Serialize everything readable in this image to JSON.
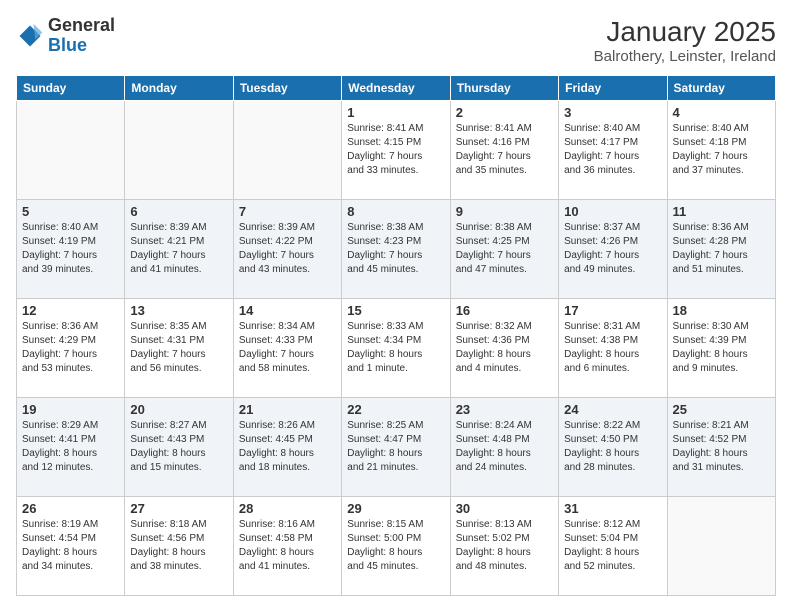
{
  "header": {
    "logo_general": "General",
    "logo_blue": "Blue",
    "month": "January 2025",
    "location": "Balrothery, Leinster, Ireland"
  },
  "weekdays": [
    "Sunday",
    "Monday",
    "Tuesday",
    "Wednesday",
    "Thursday",
    "Friday",
    "Saturday"
  ],
  "weeks": [
    [
      {
        "day": "",
        "info": ""
      },
      {
        "day": "",
        "info": ""
      },
      {
        "day": "",
        "info": ""
      },
      {
        "day": "1",
        "info": "Sunrise: 8:41 AM\nSunset: 4:15 PM\nDaylight: 7 hours\nand 33 minutes."
      },
      {
        "day": "2",
        "info": "Sunrise: 8:41 AM\nSunset: 4:16 PM\nDaylight: 7 hours\nand 35 minutes."
      },
      {
        "day": "3",
        "info": "Sunrise: 8:40 AM\nSunset: 4:17 PM\nDaylight: 7 hours\nand 36 minutes."
      },
      {
        "day": "4",
        "info": "Sunrise: 8:40 AM\nSunset: 4:18 PM\nDaylight: 7 hours\nand 37 minutes."
      }
    ],
    [
      {
        "day": "5",
        "info": "Sunrise: 8:40 AM\nSunset: 4:19 PM\nDaylight: 7 hours\nand 39 minutes."
      },
      {
        "day": "6",
        "info": "Sunrise: 8:39 AM\nSunset: 4:21 PM\nDaylight: 7 hours\nand 41 minutes."
      },
      {
        "day": "7",
        "info": "Sunrise: 8:39 AM\nSunset: 4:22 PM\nDaylight: 7 hours\nand 43 minutes."
      },
      {
        "day": "8",
        "info": "Sunrise: 8:38 AM\nSunset: 4:23 PM\nDaylight: 7 hours\nand 45 minutes."
      },
      {
        "day": "9",
        "info": "Sunrise: 8:38 AM\nSunset: 4:25 PM\nDaylight: 7 hours\nand 47 minutes."
      },
      {
        "day": "10",
        "info": "Sunrise: 8:37 AM\nSunset: 4:26 PM\nDaylight: 7 hours\nand 49 minutes."
      },
      {
        "day": "11",
        "info": "Sunrise: 8:36 AM\nSunset: 4:28 PM\nDaylight: 7 hours\nand 51 minutes."
      }
    ],
    [
      {
        "day": "12",
        "info": "Sunrise: 8:36 AM\nSunset: 4:29 PM\nDaylight: 7 hours\nand 53 minutes."
      },
      {
        "day": "13",
        "info": "Sunrise: 8:35 AM\nSunset: 4:31 PM\nDaylight: 7 hours\nand 56 minutes."
      },
      {
        "day": "14",
        "info": "Sunrise: 8:34 AM\nSunset: 4:33 PM\nDaylight: 7 hours\nand 58 minutes."
      },
      {
        "day": "15",
        "info": "Sunrise: 8:33 AM\nSunset: 4:34 PM\nDaylight: 8 hours\nand 1 minute."
      },
      {
        "day": "16",
        "info": "Sunrise: 8:32 AM\nSunset: 4:36 PM\nDaylight: 8 hours\nand 4 minutes."
      },
      {
        "day": "17",
        "info": "Sunrise: 8:31 AM\nSunset: 4:38 PM\nDaylight: 8 hours\nand 6 minutes."
      },
      {
        "day": "18",
        "info": "Sunrise: 8:30 AM\nSunset: 4:39 PM\nDaylight: 8 hours\nand 9 minutes."
      }
    ],
    [
      {
        "day": "19",
        "info": "Sunrise: 8:29 AM\nSunset: 4:41 PM\nDaylight: 8 hours\nand 12 minutes."
      },
      {
        "day": "20",
        "info": "Sunrise: 8:27 AM\nSunset: 4:43 PM\nDaylight: 8 hours\nand 15 minutes."
      },
      {
        "day": "21",
        "info": "Sunrise: 8:26 AM\nSunset: 4:45 PM\nDaylight: 8 hours\nand 18 minutes."
      },
      {
        "day": "22",
        "info": "Sunrise: 8:25 AM\nSunset: 4:47 PM\nDaylight: 8 hours\nand 21 minutes."
      },
      {
        "day": "23",
        "info": "Sunrise: 8:24 AM\nSunset: 4:48 PM\nDaylight: 8 hours\nand 24 minutes."
      },
      {
        "day": "24",
        "info": "Sunrise: 8:22 AM\nSunset: 4:50 PM\nDaylight: 8 hours\nand 28 minutes."
      },
      {
        "day": "25",
        "info": "Sunrise: 8:21 AM\nSunset: 4:52 PM\nDaylight: 8 hours\nand 31 minutes."
      }
    ],
    [
      {
        "day": "26",
        "info": "Sunrise: 8:19 AM\nSunset: 4:54 PM\nDaylight: 8 hours\nand 34 minutes."
      },
      {
        "day": "27",
        "info": "Sunrise: 8:18 AM\nSunset: 4:56 PM\nDaylight: 8 hours\nand 38 minutes."
      },
      {
        "day": "28",
        "info": "Sunrise: 8:16 AM\nSunset: 4:58 PM\nDaylight: 8 hours\nand 41 minutes."
      },
      {
        "day": "29",
        "info": "Sunrise: 8:15 AM\nSunset: 5:00 PM\nDaylight: 8 hours\nand 45 minutes."
      },
      {
        "day": "30",
        "info": "Sunrise: 8:13 AM\nSunset: 5:02 PM\nDaylight: 8 hours\nand 48 minutes."
      },
      {
        "day": "31",
        "info": "Sunrise: 8:12 AM\nSunset: 5:04 PM\nDaylight: 8 hours\nand 52 minutes."
      },
      {
        "day": "",
        "info": ""
      }
    ]
  ]
}
